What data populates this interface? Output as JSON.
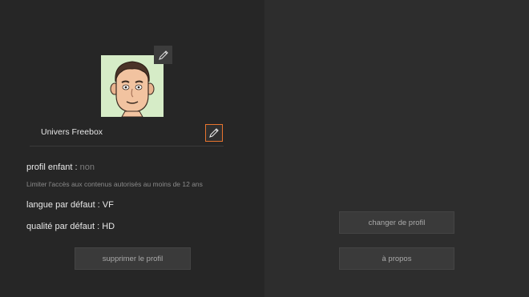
{
  "profile": {
    "name": "Univers Freebox",
    "avatar_icon": "cartoon-man-avatar",
    "edit_icon": "pencil-icon"
  },
  "settings": {
    "child_label": "profil enfant : ",
    "child_value": "non",
    "child_hint": "Limiter l'accès aux contenus autorisés au moins de 12 ans",
    "language_label": "langue par défaut : ",
    "language_value": "VF",
    "quality_label": "qualité par défaut : ",
    "quality_value": "HD"
  },
  "buttons": {
    "delete_label": "supprimer le profil",
    "switch_label": "changer de profil",
    "about_label": "à propos"
  },
  "colors": {
    "focus_border": "#e8742e",
    "avatar_bg": "#d6ecc7"
  }
}
